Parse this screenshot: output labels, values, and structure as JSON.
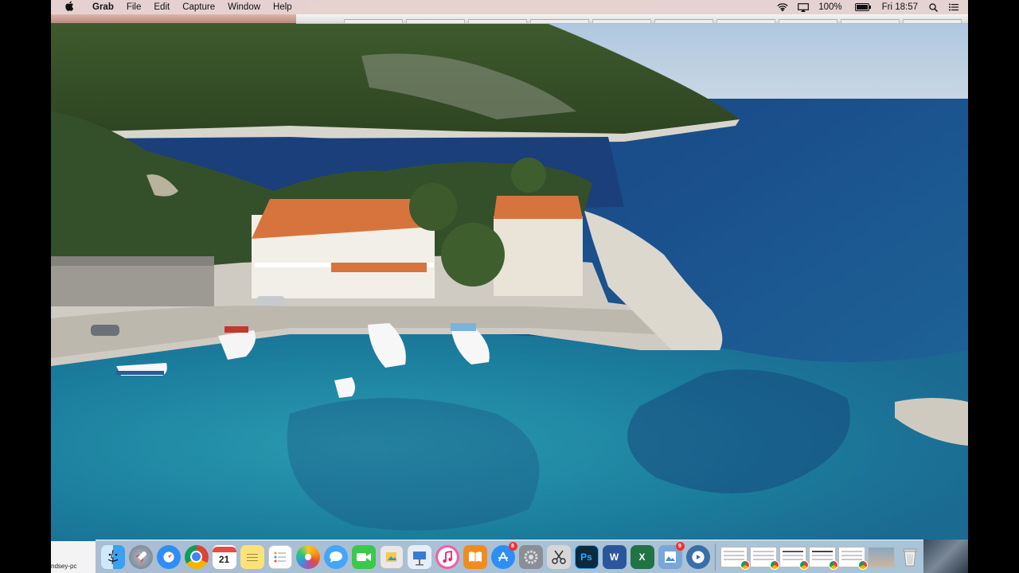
{
  "menubar": {
    "apple_icon": "apple-icon",
    "app_name": "Grab",
    "menus": [
      "File",
      "Edit",
      "Capture",
      "Window",
      "Help"
    ],
    "status": {
      "wifi_icon": "wifi-icon",
      "airplay_icon": "airplay-icon",
      "battery_percent": "100%",
      "battery_level": 1.0,
      "clock": "Fri 18:57",
      "spotlight_icon": "search-icon",
      "notification_icon": "list-icon"
    }
  },
  "desktop": {
    "wallpaper": "aerial photo of a coastal village with boats in a turquoise bay"
  },
  "dock": {
    "left_label": "ndsey-pc",
    "apps": [
      {
        "name": "Finder",
        "icon": "finder-icon",
        "color": "#3aa0f0"
      },
      {
        "name": "Launchpad",
        "icon": "rocket-icon",
        "color": "#8a95a5"
      },
      {
        "name": "Safari",
        "icon": "compass-icon",
        "color": "#2f8ef5"
      },
      {
        "name": "Chrome",
        "icon": "chrome-icon",
        "color": "#db4437"
      },
      {
        "name": "Calendar",
        "icon": "calendar-icon",
        "text": "21",
        "color": "#ffffff"
      },
      {
        "name": "Notes",
        "icon": "notes-icon",
        "color": "#fbe27a"
      },
      {
        "name": "Reminders",
        "icon": "list-icon",
        "color": "#ffffff"
      },
      {
        "name": "Photos",
        "icon": "photos-icon",
        "color": "#f3a23a"
      },
      {
        "name": "Messages",
        "icon": "chat-bubble-icon",
        "color": "#43a6f7"
      },
      {
        "name": "FaceTime",
        "icon": "video-camera-icon",
        "color": "#3cc84a"
      },
      {
        "name": "Preview",
        "icon": "preview-icon",
        "color": "#e8e8e8"
      },
      {
        "name": "Keynote",
        "icon": "presentation-icon",
        "color": "#3a7bd5"
      },
      {
        "name": "iTunes",
        "icon": "music-note-icon",
        "color": "#f45ea8"
      },
      {
        "name": "iBooks",
        "icon": "book-icon",
        "color": "#f28b1e"
      },
      {
        "name": "App Store",
        "icon": "app-store-icon",
        "color": "#2e8ef5",
        "badge": "8"
      },
      {
        "name": "System Preferences",
        "icon": "gear-icon",
        "color": "#8a8f95"
      },
      {
        "name": "Grab",
        "icon": "scissors-icon",
        "color": "#d7d7d7"
      },
      {
        "name": "Photoshop",
        "icon": "photoshop-icon",
        "text": "Ps",
        "color": "#0b2a3e"
      },
      {
        "name": "Word",
        "icon": "word-icon",
        "text": "W",
        "color": "#2b579a"
      },
      {
        "name": "Excel",
        "icon": "excel-icon",
        "text": "X",
        "color": "#217346"
      },
      {
        "name": "Preview image",
        "icon": "image-icon",
        "color": "#7aa7d8",
        "badge": "9"
      },
      {
        "name": "QuickTime",
        "icon": "quicktime-icon",
        "color": "#3a6ea8"
      }
    ],
    "minimized_windows": 6,
    "trash_icon": "trash-icon"
  }
}
